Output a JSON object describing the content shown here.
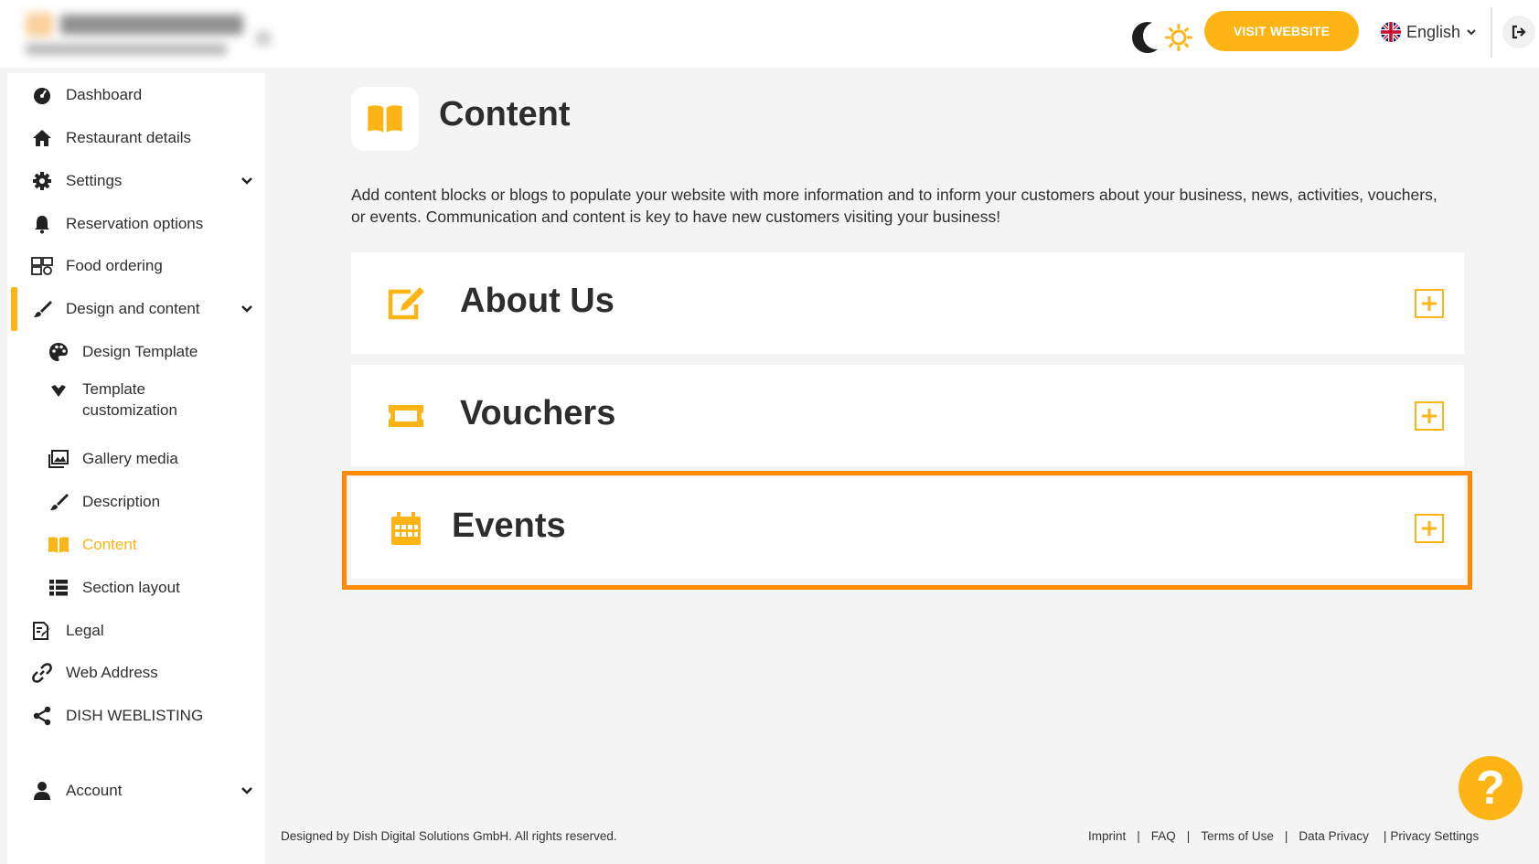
{
  "header": {
    "visit_website": "VISIT WEBSITE",
    "language": "English"
  },
  "sidebar": {
    "items": [
      {
        "label": "Dashboard",
        "icon": "dashboard-icon"
      },
      {
        "label": "Restaurant details",
        "icon": "home-icon"
      },
      {
        "label": "Settings",
        "icon": "gear-icon"
      },
      {
        "label": "Reservation options",
        "icon": "bell-icon"
      },
      {
        "label": "Food ordering",
        "icon": "food-ordering-icon"
      },
      {
        "label": "Design and content",
        "icon": "brush-icon"
      },
      {
        "label": "Design Template",
        "icon": "palette-icon"
      },
      {
        "label": "Template customization",
        "icon": "magic-icon"
      },
      {
        "label": "Gallery media",
        "icon": "gallery-icon"
      },
      {
        "label": "Description",
        "icon": "pen-icon"
      },
      {
        "label": "Content",
        "icon": "book-icon"
      },
      {
        "label": "Section layout",
        "icon": "list-icon"
      },
      {
        "label": "Legal",
        "icon": "legal-icon"
      },
      {
        "label": "Web Address",
        "icon": "link-icon"
      },
      {
        "label": "DISH WEBLISTING",
        "icon": "share-icon"
      },
      {
        "label": "Account",
        "icon": "user-icon"
      }
    ]
  },
  "main": {
    "title": "Content",
    "intro": "Add content blocks or blogs to populate your website with more information and to inform your customers about your business, news, activities, vouchers, or events. Communication and content is key to have new customers visiting your business!",
    "cards": [
      {
        "title": "About Us",
        "icon": "edit-icon"
      },
      {
        "title": "Vouchers",
        "icon": "ticket-icon"
      },
      {
        "title": "Events",
        "icon": "calendar-icon"
      }
    ]
  },
  "help": {
    "label": "?"
  },
  "footer": {
    "copyright": "Designed by Dish Digital Solutions GmbH. All rights reserved.",
    "links": [
      "Imprint",
      "FAQ",
      "Terms of Use",
      "Data Privacy",
      "Privacy Settings"
    ],
    "sep": "|"
  },
  "colors": {
    "accent": "#fdb515",
    "highlight": "#ff8a00"
  }
}
